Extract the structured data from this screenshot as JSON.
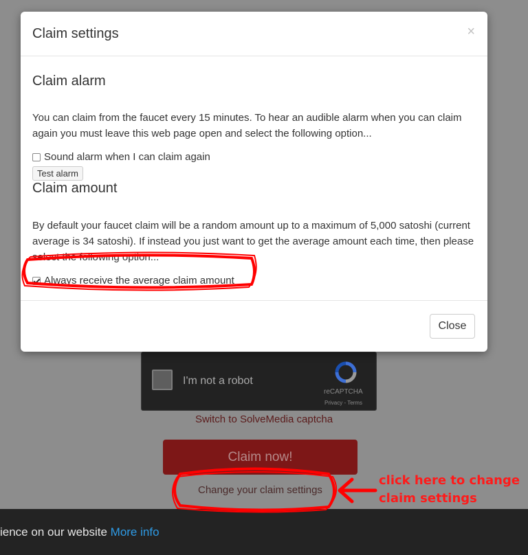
{
  "modal": {
    "title": "Claim settings",
    "close_x": "×",
    "alarm": {
      "heading": "Claim alarm",
      "text": "You can claim from the faucet every 15 minutes. To hear an audible alarm when you can claim again you must leave this web page open and select the following option...",
      "checkbox_label": "Sound alarm when I can claim again",
      "checked": false,
      "test_button": "Test alarm"
    },
    "amount": {
      "heading": "Claim amount",
      "text": "By default your faucet claim will be a random amount up to a maximum of 5,000 satoshi (current average is 34 satoshi). If instead you just want to get the average amount each time, then please select the following option...",
      "checkbox_label": "Always receive the average claim amount",
      "checked": true
    },
    "close_button": "Close"
  },
  "background": {
    "recaptcha": {
      "label": "I'm not a robot",
      "brand": "reCAPTCHA",
      "terms": "Privacy - Terms"
    },
    "switch_captcha": "Switch to SolveMedia captcha",
    "claim_button": "Claim now!",
    "change_settings": "Change your claim settings",
    "cookie": {
      "text": "ience on our website ",
      "more_info": "More info"
    }
  },
  "annotation": {
    "line1": "click here to change",
    "line2": "claim settings",
    "color": "#ff1a1a"
  }
}
